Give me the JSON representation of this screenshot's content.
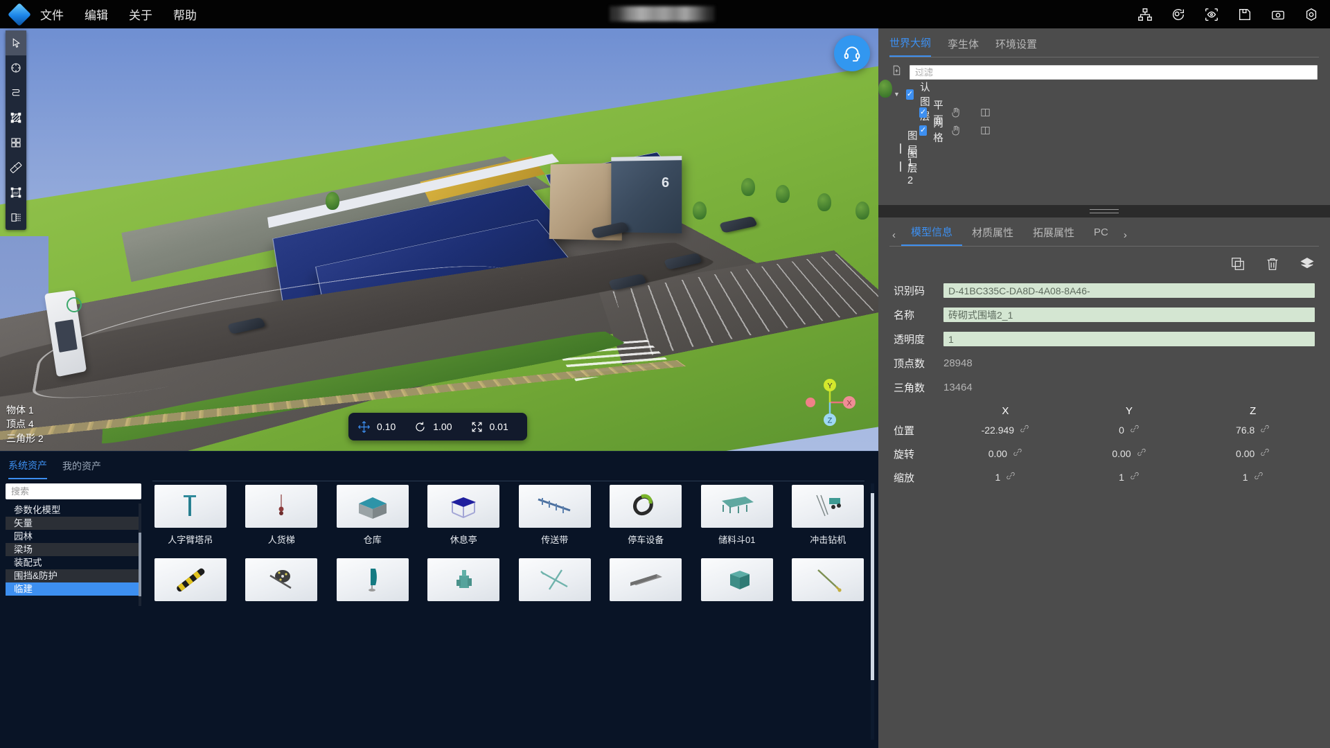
{
  "app": {
    "logo": "diamond-logo",
    "title_redacted": true
  },
  "menu": {
    "items": [
      {
        "label": "文件",
        "name": "menu-file"
      },
      {
        "label": "编辑",
        "name": "menu-edit"
      },
      {
        "label": "关于",
        "name": "menu-about"
      },
      {
        "label": "帮助",
        "name": "menu-help"
      }
    ]
  },
  "top_icons": [
    {
      "name": "hierarchy-icon"
    },
    {
      "name": "rotate-view-icon"
    },
    {
      "name": "focus-eye-icon"
    },
    {
      "name": "save-icon"
    },
    {
      "name": "camera-icon"
    },
    {
      "name": "settings-gear-icon"
    }
  ],
  "tools": [
    {
      "name": "select-arrow-tool",
      "active": true
    },
    {
      "name": "circle-tool",
      "active": false
    },
    {
      "name": "curve-tool",
      "active": false
    },
    {
      "name": "area-fill-tool",
      "active": false
    },
    {
      "name": "grid-tool",
      "active": false
    },
    {
      "name": "ruler-measure-tool",
      "active": false
    },
    {
      "name": "area-measure-tool",
      "active": false
    },
    {
      "name": "section-tool",
      "active": false
    }
  ],
  "viewport": {
    "help_button": "headset-support-icon",
    "stats": [
      {
        "label": "物体",
        "value": "1"
      },
      {
        "label": "顶点",
        "value": "4"
      },
      {
        "label": "三角形",
        "value": "2"
      }
    ],
    "axis_gizmo": {
      "x": "X",
      "y": "Y",
      "z": "Z"
    },
    "transform_bar": [
      {
        "icon": "move-icon",
        "value": "0.10",
        "name": "move-step"
      },
      {
        "icon": "rotate-icon",
        "value": "1.00",
        "name": "rotate-step"
      },
      {
        "icon": "scale-icon",
        "value": "0.01",
        "name": "scale-step"
      }
    ]
  },
  "asset_panel": {
    "tabs": [
      {
        "label": "系统资产",
        "active": true
      },
      {
        "label": "我的资产",
        "active": false
      }
    ],
    "search_placeholder": "搜索",
    "search_value": "",
    "categories": [
      {
        "label": "参数化模型",
        "selected": false
      },
      {
        "label": "矢量",
        "selected": false
      },
      {
        "label": "园林",
        "selected": false
      },
      {
        "label": "梁场",
        "selected": false
      },
      {
        "label": "装配式",
        "selected": false
      },
      {
        "label": "围挡&防护",
        "selected": false
      },
      {
        "label": "临建",
        "selected": true
      }
    ],
    "assets_row1": [
      {
        "label": "人字臂塔吊",
        "thumb": "tower-crane"
      },
      {
        "label": "人货梯",
        "thumb": "hoist"
      },
      {
        "label": "仓库",
        "thumb": "warehouse"
      },
      {
        "label": "休息亭",
        "thumb": "rest-pavilion"
      },
      {
        "label": "传送带",
        "thumb": "conveyor"
      },
      {
        "label": "停车设备",
        "thumb": "parking-device"
      },
      {
        "label": "储料斗01",
        "thumb": "hopper"
      },
      {
        "label": "冲击钻机",
        "thumb": "impact-drill"
      }
    ],
    "assets_row2": [
      {
        "label": "",
        "thumb": "speed-bump"
      },
      {
        "label": "",
        "thumb": "cable-reel"
      },
      {
        "label": "",
        "thumb": "flag-banner"
      },
      {
        "label": "",
        "thumb": "pump-machine"
      },
      {
        "label": "",
        "thumb": "cross-brace"
      },
      {
        "label": "",
        "thumb": "beam-block"
      },
      {
        "label": "",
        "thumb": "tank-cube"
      },
      {
        "label": "",
        "thumb": "crane-arm"
      }
    ]
  },
  "right_panel": {
    "outliner_tabs": [
      {
        "label": "世界大纲",
        "active": true
      },
      {
        "label": "孪生体",
        "active": false
      },
      {
        "label": "环境设置",
        "active": false
      }
    ],
    "filter_placeholder": "过滤",
    "filter_value": "",
    "add_icon": "add-file-icon",
    "tree": [
      {
        "label": "默认图层",
        "checked": true,
        "level": 0,
        "caret": "▼",
        "actions": false
      },
      {
        "label": "平面",
        "checked": true,
        "level": 1,
        "caret": "",
        "actions": true
      },
      {
        "label": "网格",
        "checked": true,
        "level": 1,
        "caret": "",
        "actions": true
      },
      {
        "label": "图层1",
        "checked": false,
        "level": 0,
        "caret": "",
        "actions": false
      },
      {
        "label": "图层2",
        "checked": false,
        "level": 0,
        "caret": "",
        "actions": false
      }
    ],
    "prop_tabs": [
      {
        "label": "模型信息",
        "active": true
      },
      {
        "label": "材质属性",
        "active": false
      },
      {
        "label": "拓展属性",
        "active": false
      },
      {
        "label": "PC",
        "active": false
      }
    ],
    "prop_nav_prev": "‹",
    "prop_nav_next": "›",
    "prop_icons": [
      {
        "name": "duplicate-icon"
      },
      {
        "name": "delete-trash-icon"
      },
      {
        "name": "layers-icon"
      }
    ],
    "fields": [
      {
        "label": "识别码",
        "value": "D-41BC335C-DA8D-4A08-8A46-",
        "editable": true,
        "name": "identifier-field"
      },
      {
        "label": "名称",
        "value": "砖砌式围墙2_1",
        "editable": true,
        "name": "name-field"
      },
      {
        "label": "透明度",
        "value": "1",
        "editable": true,
        "name": "opacity-field"
      },
      {
        "label": "顶点数",
        "value": "28948",
        "editable": false,
        "name": "vertex-count"
      },
      {
        "label": "三角数",
        "value": "13464",
        "editable": false,
        "name": "triangle-count"
      }
    ],
    "xyz_headers": [
      "X",
      "Y",
      "Z"
    ],
    "transform": [
      {
        "label": "位置",
        "x": "-22.949",
        "y": "0",
        "z": "76.8",
        "name": "position-row"
      },
      {
        "label": "旋转",
        "x": "0.00",
        "y": "0.00",
        "z": "0.00",
        "name": "rotation-row"
      },
      {
        "label": "缩放",
        "x": "1",
        "y": "1",
        "z": "1",
        "name": "scale-row"
      }
    ]
  },
  "colors": {
    "accent": "#3d8ff0",
    "panel_bg": "#4c4c4c",
    "asset_bg": "#091426",
    "field_green": "#d4e6d2"
  }
}
